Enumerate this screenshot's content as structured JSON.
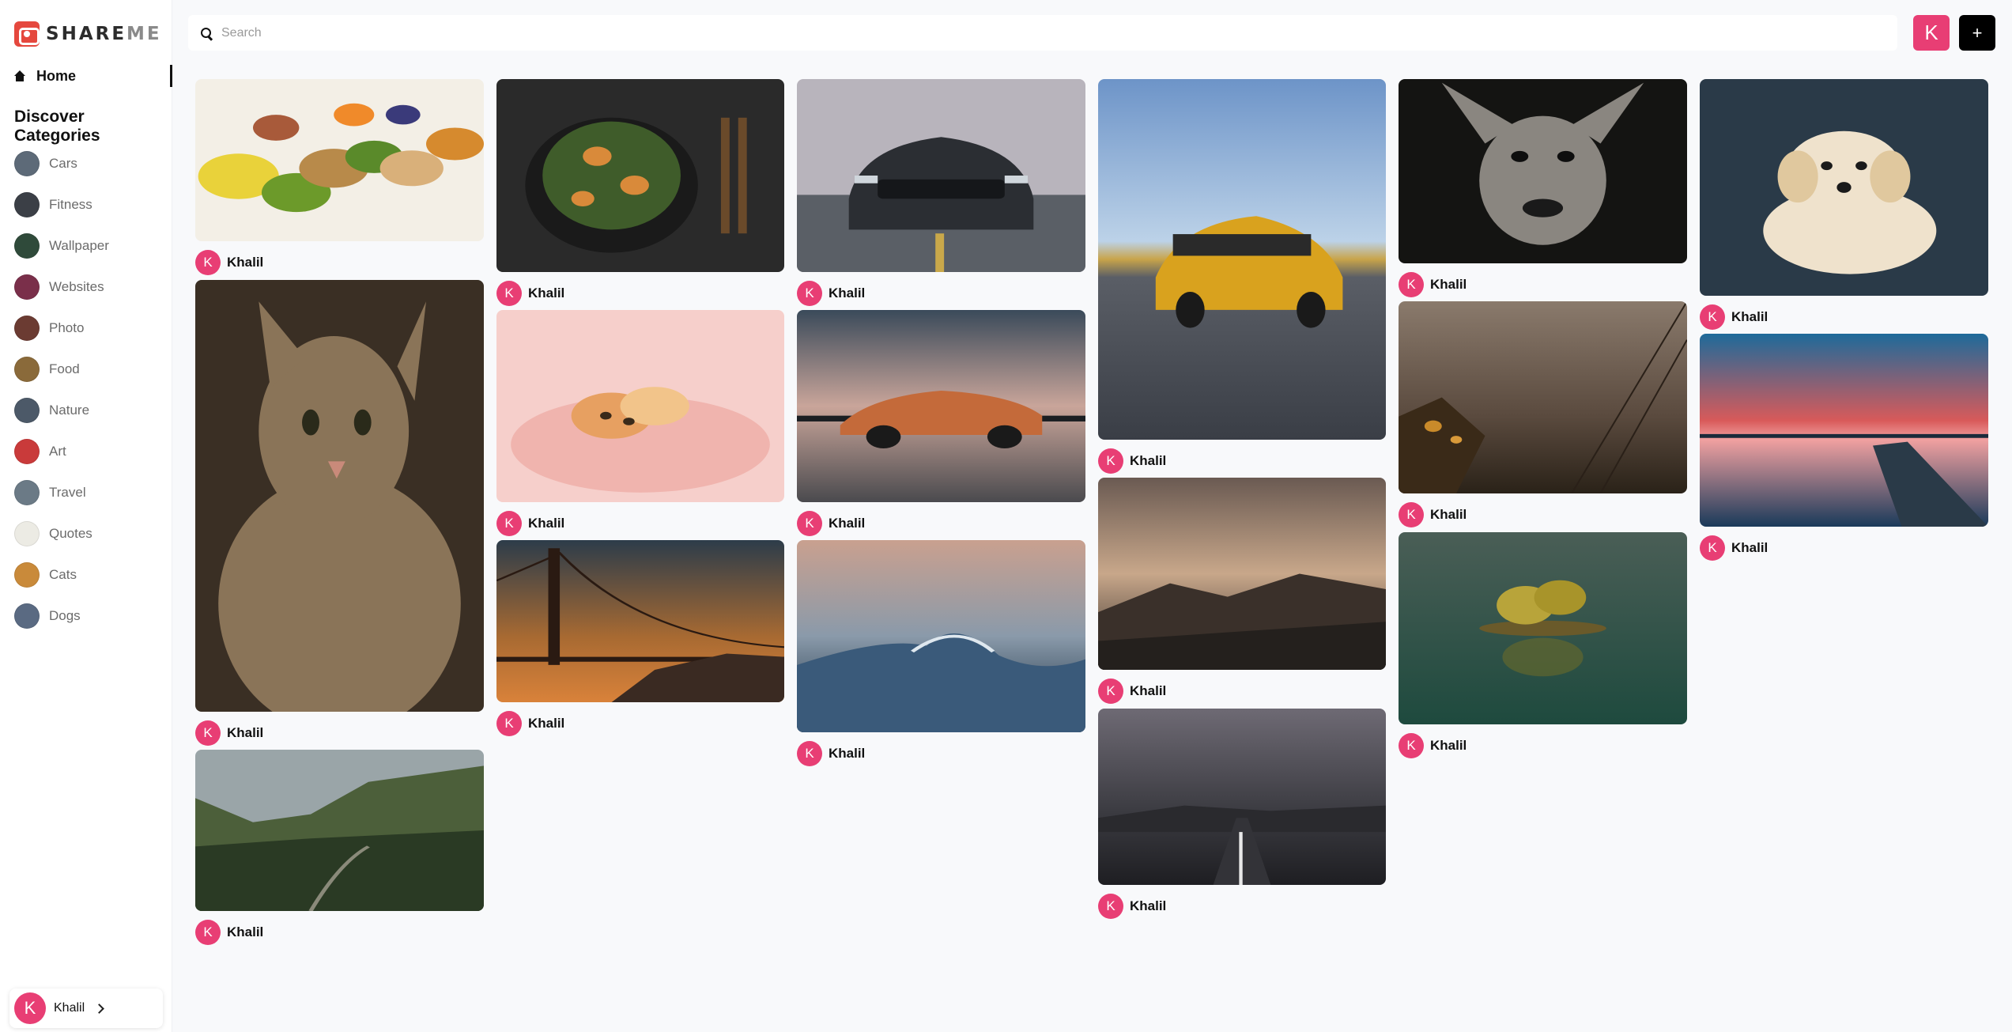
{
  "app": {
    "logo_text_bold": "SHARE",
    "logo_text_dim": "ME"
  },
  "sidebar": {
    "home_label": "Home",
    "categories_heading": "Discover Categories",
    "categories": [
      {
        "label": "Cars",
        "thumb": "#5d6a78"
      },
      {
        "label": "Fitness",
        "thumb": "#3b3f46"
      },
      {
        "label": "Wallpaper",
        "thumb": "#2f4a3a"
      },
      {
        "label": "Websites",
        "thumb": "#7a2f4a"
      },
      {
        "label": "Photo",
        "thumb": "#6b3b32"
      },
      {
        "label": "Food",
        "thumb": "#8a6a3a"
      },
      {
        "label": "Nature",
        "thumb": "#4c5968"
      },
      {
        "label": "Art",
        "thumb": "#c93a3a"
      },
      {
        "label": "Travel",
        "thumb": "#6b7a86"
      },
      {
        "label": "Quotes",
        "thumb": "#ecebe4"
      },
      {
        "label": "Cats",
        "thumb": "#c98a3a"
      },
      {
        "label": "Dogs",
        "thumb": "#5a6a82"
      }
    ],
    "profile": {
      "initial": "K",
      "name": "Khalil"
    }
  },
  "topbar": {
    "search_placeholder": "Search",
    "search_value": "",
    "user_initial": "K",
    "add_label": "+"
  },
  "feed": {
    "pins": [
      {
        "subject": "food",
        "user": "Khalil",
        "initial": "K",
        "colors": [
          "#f3efe6",
          "#9bb34a",
          "#d68a2e"
        ]
      },
      {
        "subject": "cat",
        "user": "Khalil",
        "initial": "K",
        "colors": [
          "#3a2f24",
          "#8a7458",
          "#1e1a15"
        ]
      },
      {
        "subject": "valley",
        "user": "Khalil",
        "initial": "K",
        "colors": [
          "#9aa5a8",
          "#4c5f3a",
          "#2a3a24"
        ]
      },
      {
        "subject": "wok",
        "user": "Khalil",
        "initial": "K",
        "colors": [
          "#2a2a2a",
          "#3f5c2a",
          "#111111"
        ]
      },
      {
        "subject": "kitten",
        "user": "Khalil",
        "initial": "K",
        "colors": [
          "#f6cfcb",
          "#f0b4ae",
          "#e7a061"
        ]
      },
      {
        "subject": "bridge",
        "user": "Khalil",
        "initial": "K",
        "colors": [
          "#2c3c4a",
          "#a86a32",
          "#d9823a"
        ]
      },
      {
        "subject": "mustang",
        "user": "Khalil",
        "initial": "K",
        "colors": [
          "#b8b4bc",
          "#5a5f66",
          "#2b2e33"
        ]
      },
      {
        "subject": "corvette",
        "user": "Khalil",
        "initial": "K",
        "colors": [
          "#3a4a5a",
          "#c46a3a",
          "#4a4a4e"
        ]
      },
      {
        "subject": "wave",
        "user": "Khalil",
        "initial": "K",
        "colors": [
          "#c9a08f",
          "#3a5a7a",
          "#13283c"
        ]
      },
      {
        "subject": "mercedes",
        "user": "Khalil",
        "initial": "K",
        "colors": [
          "#6d94c8",
          "#d9a21e",
          "#5a5e66"
        ]
      },
      {
        "subject": "mountains",
        "user": "Khalil",
        "initial": "K",
        "colors": [
          "#6a5a52",
          "#c8a78a",
          "#2f2a28"
        ]
      },
      {
        "subject": "road",
        "user": "Khalil",
        "initial": "K",
        "colors": [
          "#6e6a74",
          "#3a3a40",
          "#1e1e22"
        ]
      },
      {
        "subject": "dog",
        "user": "Khalil",
        "initial": "K",
        "colors": [
          "#2a2a28",
          "#8a8680",
          "#141412"
        ]
      },
      {
        "subject": "fog",
        "user": "Khalil",
        "initial": "K",
        "colors": [
          "#8a7a6c",
          "#5a4a3e",
          "#2a2218"
        ]
      },
      {
        "subject": "island",
        "user": "Khalil",
        "initial": "K",
        "colors": [
          "#4a5e56",
          "#b8a43a",
          "#1e4a3e"
        ]
      },
      {
        "subject": "puppy",
        "user": "Khalil",
        "initial": "K",
        "colors": [
          "#2a3a48",
          "#efe2cc",
          "#5a6a78"
        ]
      },
      {
        "subject": "sunset",
        "user": "Khalil",
        "initial": "K",
        "colors": [
          "#1e6a9a",
          "#d85a5a",
          "#1a3a5a"
        ]
      }
    ]
  }
}
